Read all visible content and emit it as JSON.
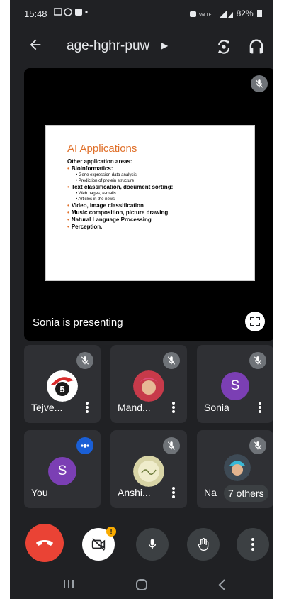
{
  "status_bar": {
    "time": "15:48",
    "battery": "82%"
  },
  "meeting": {
    "code": "age-hghr-puw"
  },
  "slide": {
    "title": "AI Applications",
    "intro": "Other application areas:",
    "items": [
      {
        "text": "Bioinformatics:",
        "subs": [
          "Gene expression data analysis",
          "Prediction of protein structure"
        ]
      },
      {
        "text": "Text classification, document sorting:",
        "subs": [
          "Web pages, e-mails",
          "Articles in the news"
        ]
      },
      {
        "text": "Video, image classification",
        "subs": []
      },
      {
        "text": "Music composition, picture drawing",
        "subs": []
      },
      {
        "text": "Natural Language Processing",
        "subs": []
      },
      {
        "text": "Perception.",
        "subs": []
      }
    ]
  },
  "presenting_label": "Sonia is presenting",
  "participants": [
    {
      "name": "Tejve...",
      "avatar": "logo"
    },
    {
      "name": "Mand...",
      "avatar": "photo"
    },
    {
      "name": "Sonia",
      "avatar": "S"
    },
    {
      "name": "You",
      "avatar": "S"
    },
    {
      "name": "Anshi...",
      "avatar": "photo"
    },
    {
      "name": "Na",
      "avatar": "photo"
    }
  ],
  "others_label": "7 others",
  "colors": {
    "background": "#202124",
    "tile": "#2f3034",
    "end_call": "#ea4335",
    "avatar_purple": "#7b3fb4",
    "slide_title": "#e0702a",
    "speaking_badge": "#1a5fd6"
  }
}
